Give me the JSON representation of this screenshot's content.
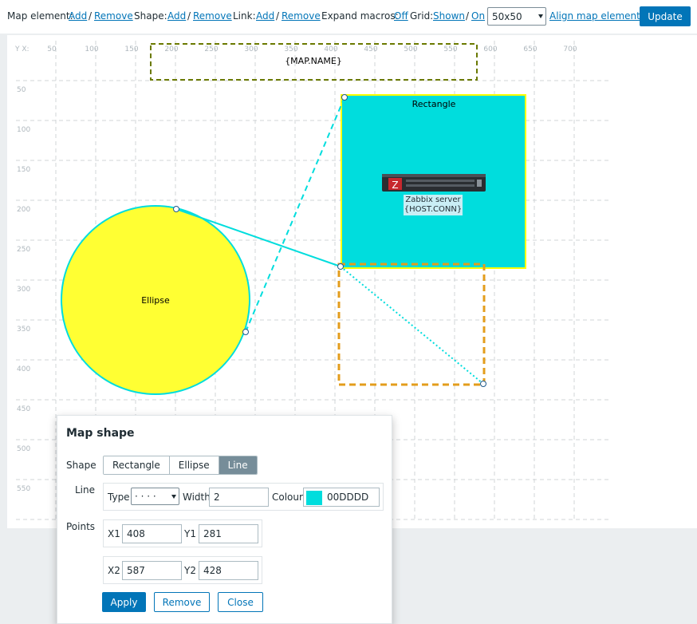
{
  "toolbar": {
    "map_element_label": "Map element:",
    "shape_label": "Shape:",
    "link_label": "Link:",
    "add": "Add",
    "remove": "Remove",
    "separator": "/",
    "expand_macros_label": "Expand macros:",
    "expand_macros_value": "Off",
    "grid_label": "Grid:",
    "grid_shown": "Shown",
    "grid_on": "On",
    "grid_size": "50x50",
    "align": "Align map elements",
    "update": "Update"
  },
  "map": {
    "corner_label": "Y X:",
    "x_ticks": [
      "50",
      "100",
      "150",
      "200",
      "250",
      "300",
      "350",
      "400",
      "450",
      "500",
      "550",
      "600",
      "650",
      "700"
    ],
    "y_ticks": [
      "50",
      "100",
      "150",
      "200",
      "250",
      "300",
      "350",
      "400",
      "450",
      "500",
      "550"
    ],
    "map_name": "{MAP.NAME}",
    "rectangle_label": "Rectangle",
    "ellipse_label": "Ellipse",
    "host_name": "Zabbix server",
    "host_conn": "{HOST.CONN}",
    "colors": {
      "rectangle_fill": "#00dddd",
      "rectangle_border": "#ffff00",
      "ellipse_fill": "#ffff33",
      "ellipse_border": "#00dddd",
      "line_color": "#00dddd",
      "map_name_border": "#6b7a00",
      "selection_border": "#e39d1c"
    }
  },
  "dialog": {
    "title": "Map shape",
    "shape_label": "Shape",
    "shape_options": [
      "Rectangle",
      "Ellipse",
      "Line"
    ],
    "shape_selected": "Line",
    "line_label": "Line",
    "type_label": "Type",
    "type_value": "· · · ·",
    "width_label": "Width",
    "width_value": "2",
    "colour_label": "Colour",
    "colour_value": "00DDDD",
    "points_label": "Points",
    "x1_label": "X1",
    "x1_value": "408",
    "y1_label": "Y1",
    "y1_value": "281",
    "x2_label": "X2",
    "x2_value": "587",
    "y2_label": "Y2",
    "y2_value": "428",
    "apply": "Apply",
    "remove": "Remove",
    "close": "Close"
  }
}
